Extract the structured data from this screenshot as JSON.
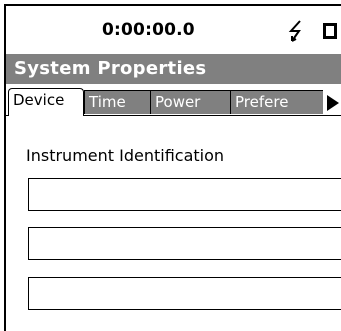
{
  "status": {
    "clock": "0:00:00.0",
    "power_icon": "lightning-bolt-icon",
    "battery_icon": "battery-icon"
  },
  "window": {
    "title": "System Properties"
  },
  "tabs": [
    {
      "label": "Device",
      "active": true
    },
    {
      "label": "Time",
      "active": false
    },
    {
      "label": "Power",
      "active": false
    },
    {
      "label": "Prefere",
      "active": false
    }
  ],
  "tab_scroll_icon": "triangle-right-icon",
  "section": {
    "label": "Instrument Identification"
  },
  "fields": [
    {
      "value": ""
    },
    {
      "value": ""
    },
    {
      "value": ""
    }
  ],
  "colors": {
    "title_bar_bg": "#808080",
    "inactive_tab_bg": "#808080",
    "text": "#000000",
    "background": "#ffffff"
  }
}
